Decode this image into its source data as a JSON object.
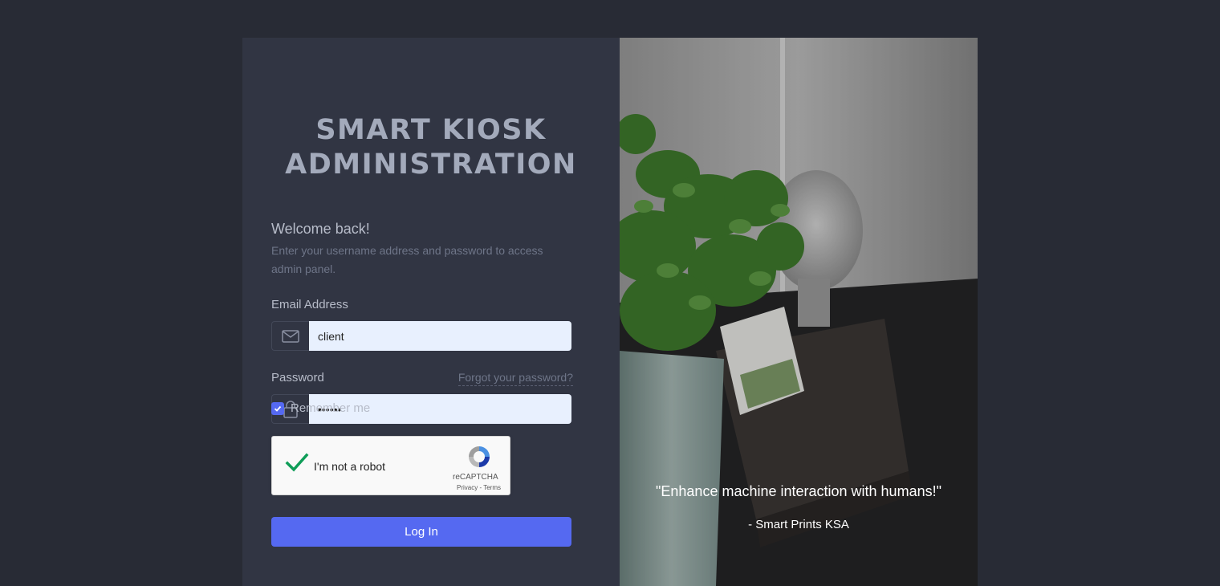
{
  "brand": {
    "line1": "SMART KIOSK",
    "line2": "ADMINISTRATION"
  },
  "login": {
    "welcome": "Welcome back!",
    "subtitle": "Enter your username address and password to access admin panel.",
    "email_label": "Email Address",
    "email_value": "client",
    "password_label": "Password",
    "password_value": "••••••",
    "forgot_link": "Forgot your password?",
    "remember_label": "Remember me",
    "remember_checked": true,
    "submit_label": "Log In"
  },
  "captcha": {
    "label": "I'm not a robot",
    "brand": "reCAPTCHA",
    "privacy": "Privacy",
    "separator": " - ",
    "terms": "Terms"
  },
  "hero": {
    "quote": "\"Enhance machine interaction with humans!\"",
    "author": "- Smart Prints KSA"
  },
  "colors": {
    "page_bg": "#282b35",
    "panel_bg": "#313543",
    "accent": "#5569f1",
    "input_bg": "#e8f0fe",
    "check_green": "#0f9d58"
  },
  "icons": {
    "email": "envelope-icon",
    "password": "lock-icon",
    "remember": "check-icon",
    "captcha_check": "checkmark-icon",
    "captcha_logo": "recaptcha-logo"
  }
}
